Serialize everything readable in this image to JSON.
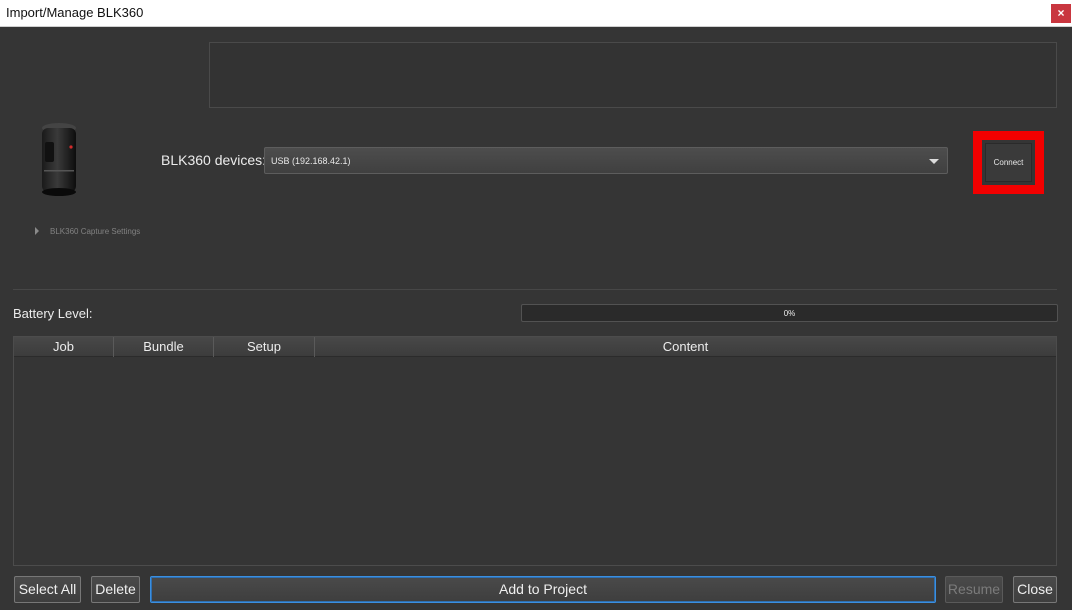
{
  "window": {
    "title": "Import/Manage BLK360",
    "close_glyph": "×"
  },
  "devices": {
    "label": "BLK360 devices:",
    "selected": "USB (192.168.42.1)"
  },
  "connect_label": "Connect",
  "capture_settings_label": "BLK360 Capture Settings",
  "battery": {
    "label": "Battery Level:",
    "value_text": "0%",
    "value": 0
  },
  "table": {
    "columns": [
      "Job",
      "Bundle",
      "Setup",
      "Content"
    ],
    "rows": []
  },
  "buttons": {
    "select_all": "Select All",
    "delete": "Delete",
    "add_to_project": "Add to Project",
    "resume": "Resume",
    "close": "Close"
  },
  "colors": {
    "highlight": "#f20000",
    "accent": "#3b8fe0",
    "window_close": "#c9363f"
  },
  "icons": {
    "device": "blk360-scanner-icon",
    "expand": "triangle-right-icon",
    "dropdown": "chevron-down-icon"
  }
}
